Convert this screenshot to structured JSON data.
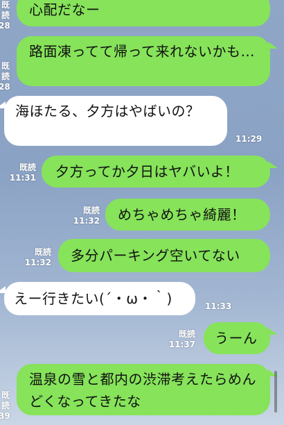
{
  "messages": [
    {
      "side": "right",
      "text": "心配だなー",
      "read": "既読",
      "time": "28"
    },
    {
      "side": "right",
      "text": "路面凍ってて帰って来れないかも…",
      "read": "既読",
      "time": "28"
    },
    {
      "side": "left",
      "text": "海ほたる、夕方はやばいの？",
      "time": "11:29"
    },
    {
      "side": "right",
      "text": "夕方ってか夕日はヤバいよ！",
      "read": "既読",
      "time": "11:31"
    },
    {
      "side": "right",
      "text": "めちゃめちゃ綺麗！",
      "read": "既読",
      "time": "11:32"
    },
    {
      "side": "right",
      "text": "多分パーキング空いてない",
      "read": "既読",
      "time": "11:32"
    },
    {
      "side": "left",
      "text": "えー行きたい(´・ω・｀)",
      "time": "11:33"
    },
    {
      "side": "right",
      "text": "うーん",
      "read": "既読",
      "time": "11:37"
    },
    {
      "side": "right",
      "text": "温泉の雪と都内の渋滞考えたらめんどくなってきたな",
      "read": "既読",
      "time": "39"
    }
  ],
  "colors": {
    "sent_bubble": "#86e35a",
    "received_bubble": "#ffffff"
  }
}
